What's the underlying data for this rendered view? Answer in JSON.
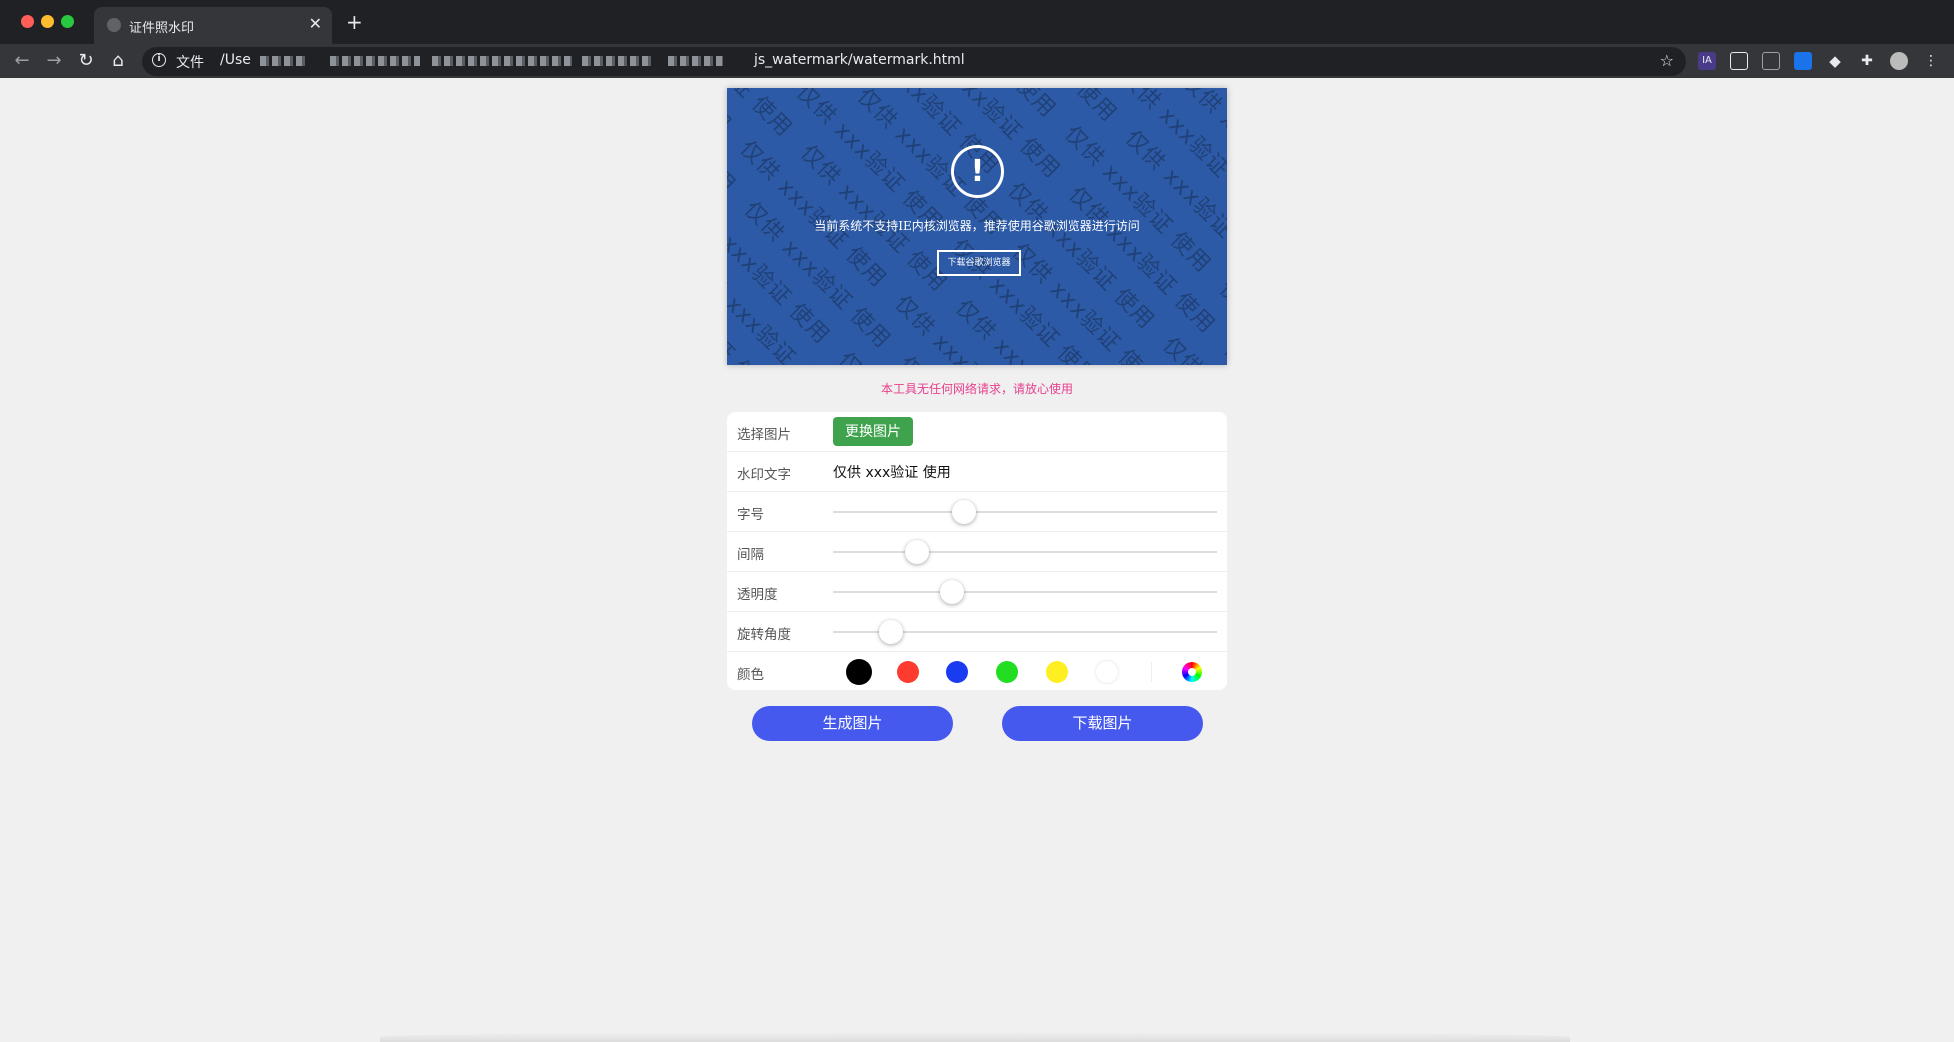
{
  "browser": {
    "tab_title": "证件照水印",
    "tab_close": "✕",
    "new_tab": "+",
    "scheme_label": "文件",
    "url_prefix": "/Use",
    "url_visible": "js_watermark/watermark.html",
    "ext_ia": "IA"
  },
  "preview": {
    "watermark_text": "仅供 xxx验证 使用",
    "alert_icon": "!",
    "alert_message": "当前系统不支持IE内核浏览器，推荐使用谷歌浏览器进行访问",
    "alert_button": "下载谷歌浏览器",
    "background_color": "#2d5aa6"
  },
  "notice": "本工具无任何网络请求，请放心使用",
  "form": {
    "choose_image": {
      "label": "选择图片",
      "button": "更换图片"
    },
    "watermark_text": {
      "label": "水印文字",
      "value": "仅供 xxx验证 使用"
    },
    "font_size": {
      "label": "字号",
      "value_fraction": 0.34
    },
    "spacing": {
      "label": "间隔",
      "value_fraction": 0.22
    },
    "opacity": {
      "label": "透明度",
      "value_fraction": 0.31
    },
    "rotation": {
      "label": "旋转角度",
      "value_fraction": 0.15
    },
    "color": {
      "label": "颜色",
      "swatches": [
        "#000000",
        "#ff3b30",
        "#1a3cf0",
        "#22dd22",
        "#ffee22",
        "#ffffff"
      ],
      "selected": "#000000"
    }
  },
  "actions": {
    "generate": "生成图片",
    "download": "下载图片"
  }
}
